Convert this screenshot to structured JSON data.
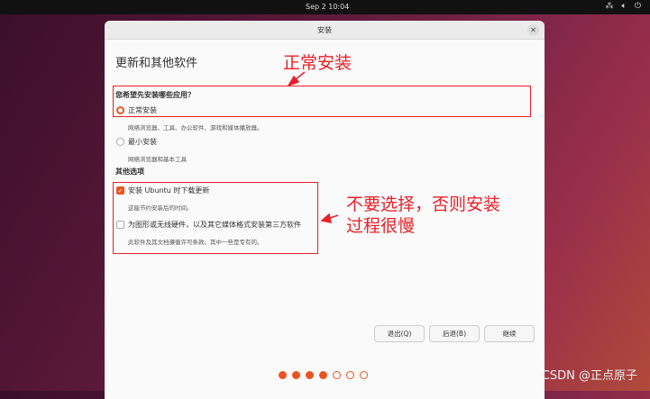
{
  "topbar": {
    "clock": "Sep 2  10:04",
    "icons": [
      "network-icon",
      "volume-icon",
      "power-icon"
    ]
  },
  "window": {
    "title": "安装",
    "heading": "更新和其他软件",
    "question": "您希望先安装哪些应用？",
    "normal": {
      "label": "正常安装",
      "desc": "网络浏览器、工具、办公软件、游戏和媒体播放器。",
      "selected": true
    },
    "minimal": {
      "label": "最小安装",
      "desc": "网络浏览器和基本工具",
      "selected": false
    },
    "other_heading": "其他选项",
    "updates": {
      "label": "安装 Ubuntu 时下载更新",
      "desc": "这能节约安装后的时间。",
      "checked": true
    },
    "thirdparty": {
      "label": "为图形或无线硬件，以及其它媒体格式安装第三方软件",
      "desc": "此软件及其文档遵循许可条款。其中一些是专有的。",
      "checked": false
    },
    "buttons": {
      "quit": "退出(Q)",
      "back": "后退(B)",
      "continue": "继续"
    },
    "progress": {
      "step": 4,
      "total": 7
    }
  },
  "annotations": {
    "note1": "正常安装",
    "note2_line1": "不要选择，否则安装",
    "note2_line2": "过程很慢",
    "color": "#e8202a"
  },
  "watermark": "CSDN @正点原子"
}
